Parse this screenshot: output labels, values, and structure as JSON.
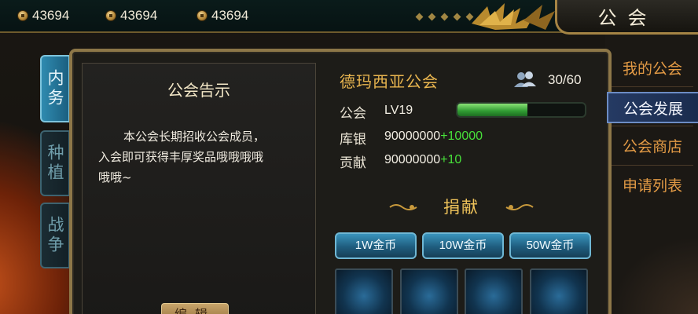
{
  "topbar": {
    "currencies": [
      {
        "value": "43694",
        "icon": "coin-icon"
      },
      {
        "value": "43694",
        "icon": "coin-icon"
      },
      {
        "value": "43694",
        "icon": "coin-icon"
      }
    ],
    "title": "公会"
  },
  "left_tabs": [
    {
      "label": "内务",
      "active": true
    },
    {
      "label": "种植",
      "active": false
    },
    {
      "label": "战争",
      "active": false
    }
  ],
  "notice": {
    "title": "公会告示",
    "line1": "本公会长期招收公会成员，",
    "line2": "入会即可获得丰厚奖品哦哦哦哦",
    "line3": "哦哦~",
    "edit_label": "编辑"
  },
  "guild": {
    "name": "德玛西亚公会",
    "members": "30/60",
    "level_label": "公会",
    "level_value": "LV19",
    "level_progress": 0.55,
    "treasury_label": "库银",
    "treasury_value": "90000000",
    "treasury_plus": "+10000",
    "contrib_label": "贡献",
    "contrib_value": "90000000",
    "contrib_plus": "+10"
  },
  "donate": {
    "title": "捐献",
    "buttons": [
      "1W金币",
      "10W金币",
      "50W金币"
    ]
  },
  "right_menu": [
    {
      "label": "我的公会",
      "active": false
    },
    {
      "label": "公会发展",
      "active": true
    },
    {
      "label": "公会商店",
      "active": false
    },
    {
      "label": "申请列表",
      "active": false
    }
  ],
  "colors": {
    "accent_gold": "#e8b54f",
    "plus_green": "#47e03a",
    "tab_blue": "#2f8bb0",
    "menu_orange": "#e29a45"
  }
}
